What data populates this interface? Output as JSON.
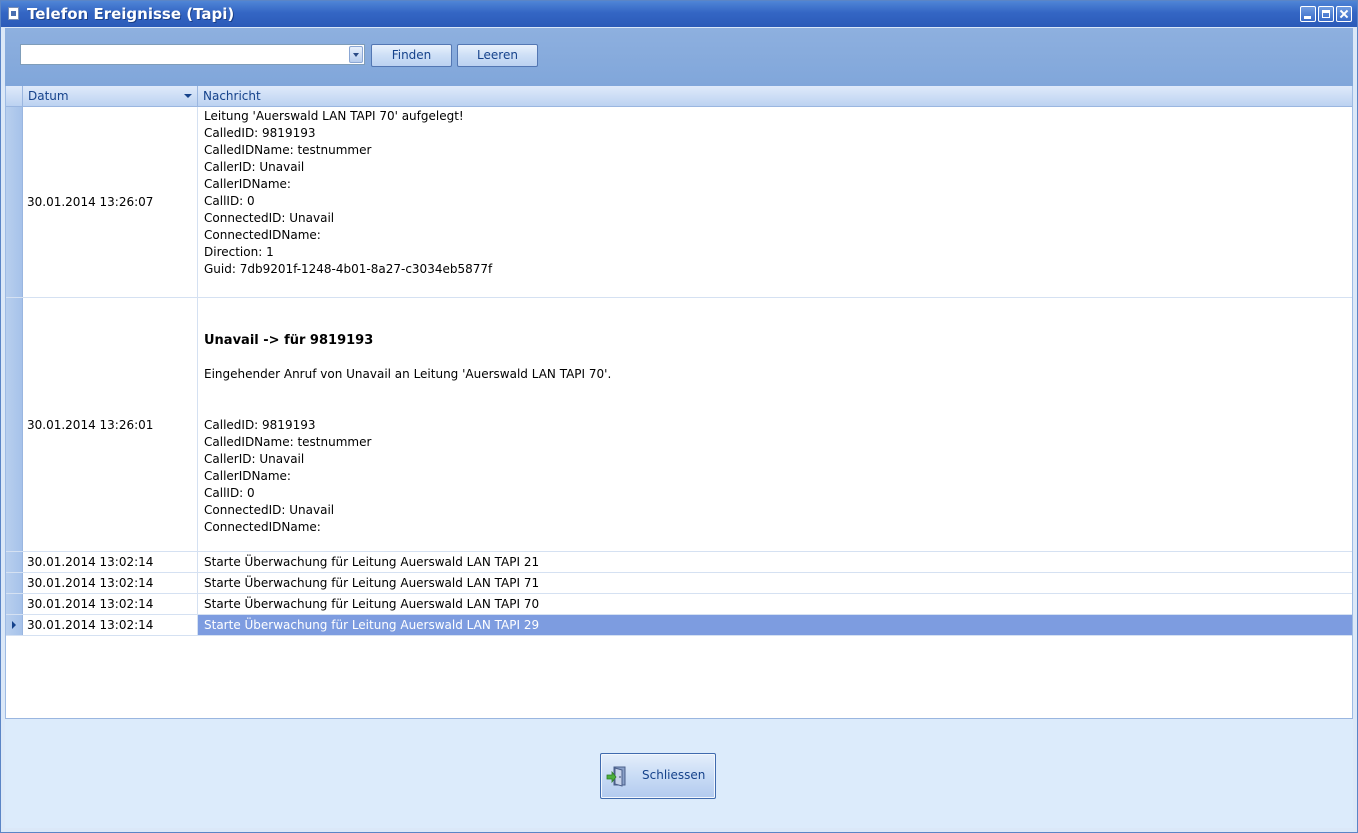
{
  "window": {
    "title": "Telefon Ereignisse (Tapi)"
  },
  "toolbar": {
    "search_value": "",
    "find_label": "Finden",
    "clear_label": "Leeren"
  },
  "grid": {
    "columns": [
      "Datum",
      "Nachricht"
    ],
    "rows": [
      {
        "date": "30.01.2014 13:26:07",
        "lines": [
          "Leitung 'Auerswald LAN TAPI 70' aufgelegt!",
          "CalledID: 9819193",
          "CalledIDName: testnummer",
          "CallerID: Unavail",
          "CallerIDName:",
          "CallID: 0",
          "ConnectedID: Unavail",
          "ConnectedIDName:",
          "Direction: 1",
          "Guid: 7db9201f-1248-4b01-8a27-c3034eb5877f"
        ]
      },
      {
        "date": "30.01.2014 13:26:01",
        "heading": "Unavail -> für 9819193",
        "intro": "Eingehender Anruf von Unavail an Leitung 'Auerswald LAN TAPI 70'.",
        "lines": [
          "CalledID: 9819193",
          "CalledIDName: testnummer",
          "CallerID: Unavail",
          "CallerIDName:",
          "CallID: 0",
          "ConnectedID: Unavail",
          "ConnectedIDName:"
        ]
      },
      {
        "date": "30.01.2014 13:02:14",
        "message": "Starte Überwachung für Leitung Auerswald LAN TAPI 21"
      },
      {
        "date": "30.01.2014 13:02:14",
        "message": "Starte Überwachung für Leitung Auerswald LAN TAPI 71"
      },
      {
        "date": "30.01.2014 13:02:14",
        "message": "Starte Überwachung für Leitung Auerswald LAN TAPI 70"
      },
      {
        "date": "30.01.2014 13:02:14",
        "message": "Starte Überwachung für Leitung Auerswald LAN TAPI 29",
        "selected": true
      }
    ]
  },
  "footer": {
    "close_label": "Schliessen",
    "close_icon": "exit-door-icon"
  }
}
